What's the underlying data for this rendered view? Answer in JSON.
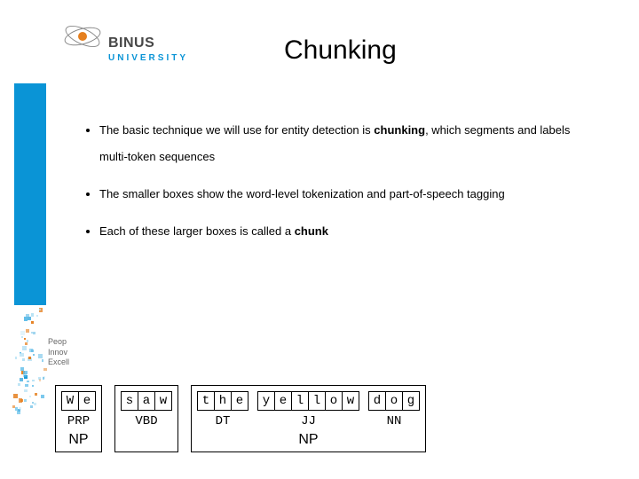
{
  "logo": {
    "name": "BINUS",
    "sub": "UNIVERSITY"
  },
  "title": "Chunking",
  "bullets": {
    "b1a": "The basic technique we will use for entity detection is ",
    "b1b": "chunking",
    "b1c": ", which segments and labels multi-token sequences",
    "b2": "The smaller boxes show the word-level tokenization and part-of-speech tagging",
    "b3a": "Each of these larger boxes is called a ",
    "b3b": "chunk"
  },
  "side_label": {
    "l1": "Peop",
    "l2": "Innov",
    "l3": "Excell"
  },
  "chart_data": {
    "type": "table",
    "description": "Chunking diagram showing word-level letters, POS tags, and NP chunks",
    "chunks": [
      {
        "label": "NP",
        "words": [
          {
            "letters": [
              "W",
              "e"
            ],
            "pos": "PRP"
          }
        ]
      },
      {
        "label": "",
        "words": [
          {
            "letters": [
              "s",
              "a",
              "w"
            ],
            "pos": "VBD"
          }
        ]
      },
      {
        "label": "NP",
        "words": [
          {
            "letters": [
              "t",
              "h",
              "e"
            ],
            "pos": "DT"
          },
          {
            "letters": [
              "y",
              "e",
              "l",
              "l",
              "o",
              "w"
            ],
            "pos": "JJ"
          },
          {
            "letters": [
              "d",
              "o",
              "g"
            ],
            "pos": "NN"
          }
        ]
      }
    ]
  }
}
